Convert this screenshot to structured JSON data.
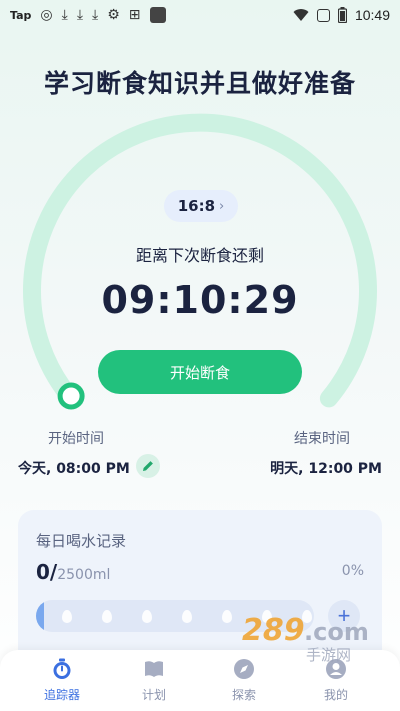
{
  "status_bar": {
    "left_label": "Tap",
    "time": "10:49"
  },
  "title": "学习断食知识并且做好准备",
  "timer": {
    "plan_ratio": "16:8",
    "countdown_label": "距离下次断食还剩",
    "countdown": "09:10:29",
    "start_button": "开始断食"
  },
  "schedule": {
    "start_label": "开始时间",
    "start_value": "今天, 08:00 PM",
    "end_label": "结束时间",
    "end_value": "明天, 12:00 PM"
  },
  "water": {
    "title": "每日喝水记录",
    "amount": "0/",
    "goal": "2500ml",
    "percent": "0%",
    "progress": 0,
    "drops": 7
  },
  "tabbar": {
    "items": [
      {
        "label": "追踪器",
        "icon": "stopwatch-icon",
        "active": true
      },
      {
        "label": "计划",
        "icon": "book-icon",
        "active": false
      },
      {
        "label": "探索",
        "icon": "compass-icon",
        "active": false
      },
      {
        "label": "我的",
        "icon": "profile-icon",
        "active": false
      }
    ]
  },
  "watermark": "289.com 手游网",
  "colors": {
    "accent_green": "#22c17d",
    "ring_green": "#cdf2e2",
    "blue": "#3b6fe0"
  }
}
